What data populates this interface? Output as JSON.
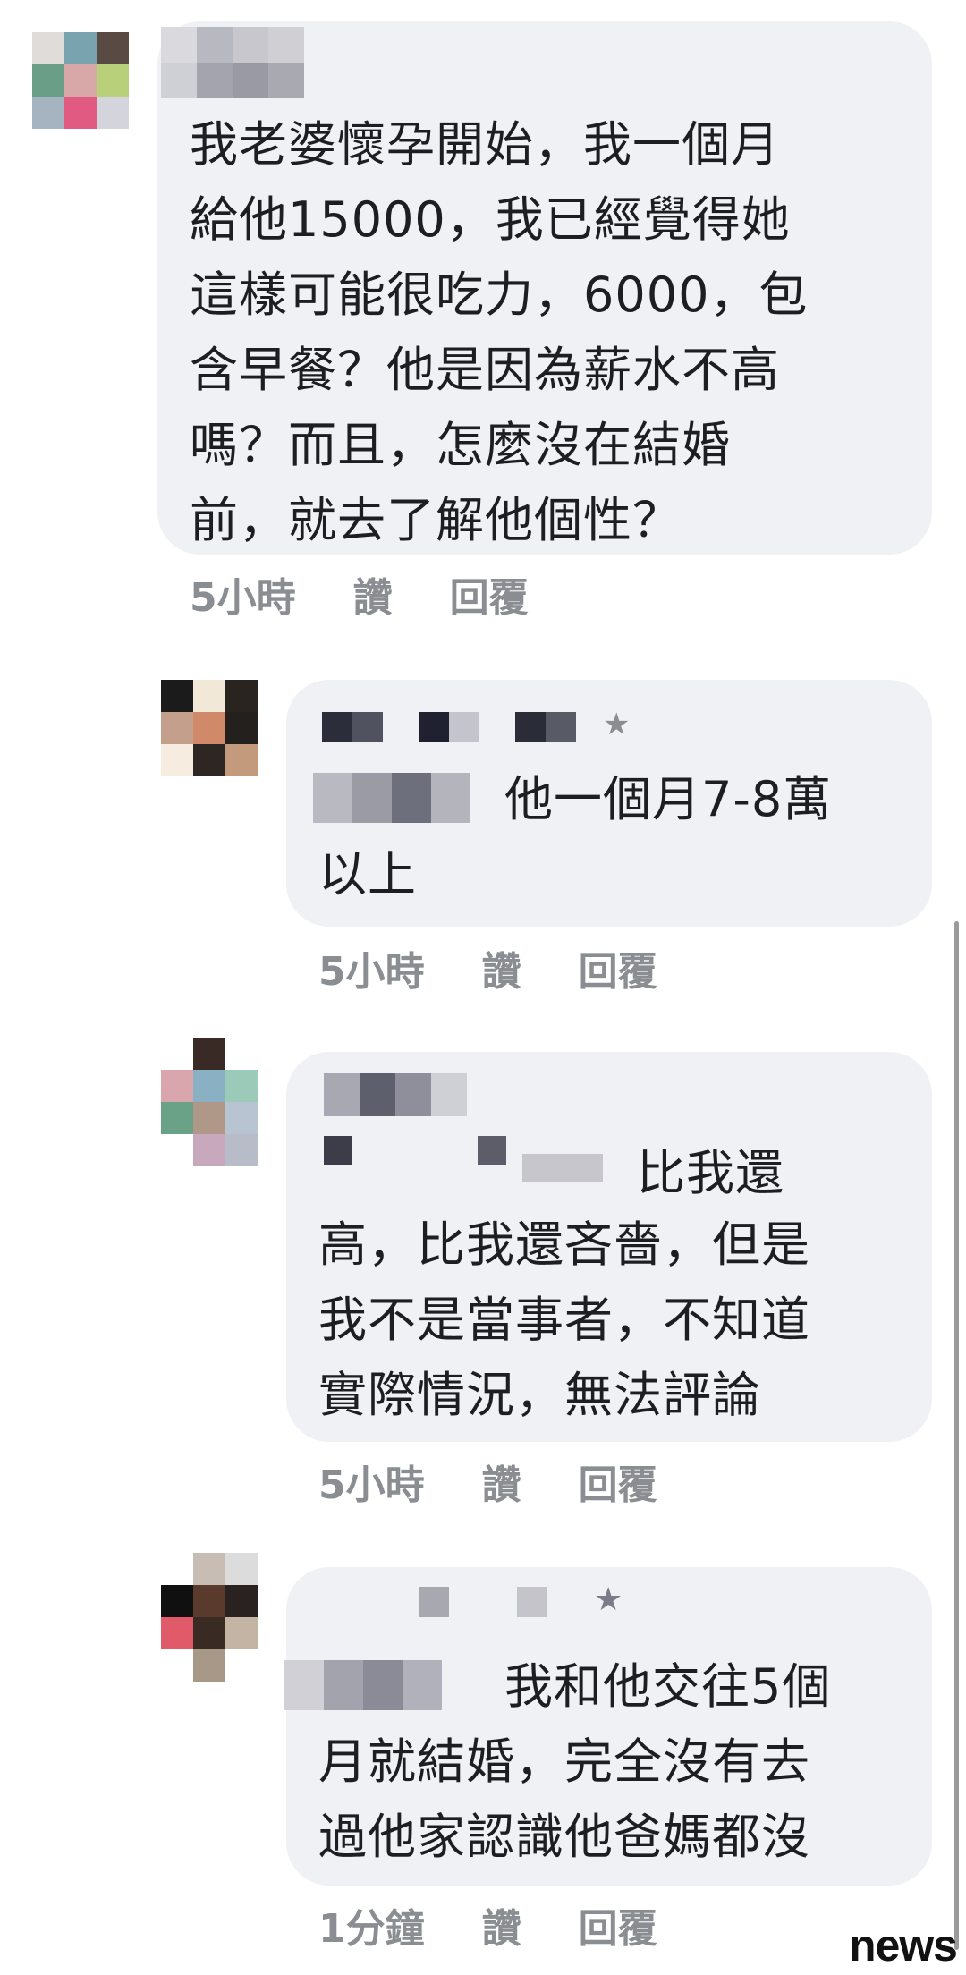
{
  "comments": [
    {
      "text": "我老婆懷孕開始，我一個月\n給他15000，我已經覺得她\n這樣可能很吃力，6000，包\n含早餐？他是因為薪水不高\n嗎？而且，怎麼沒在結婚\n前，就去了解他個性？",
      "time": "5小時",
      "like": "讚",
      "reply": "回覆"
    },
    {
      "text": "他一個月7-8萬\n以上",
      "time": "5小時",
      "like": "讚",
      "reply": "回覆"
    },
    {
      "text_line1": "比我還",
      "text_rest": "高，比我還吝嗇，但是\n我不是當事者，不知道\n實際情況，無法評論",
      "time": "5小時",
      "like": "讚",
      "reply": "回覆"
    },
    {
      "text": "我和他交往5個\n月就結婚，完全沒有去\n過他家認識他爸媽都沒",
      "time": "1分鐘",
      "like": "讚",
      "reply": "回覆"
    }
  ],
  "watermark": "news",
  "icons": {
    "star": "★"
  }
}
